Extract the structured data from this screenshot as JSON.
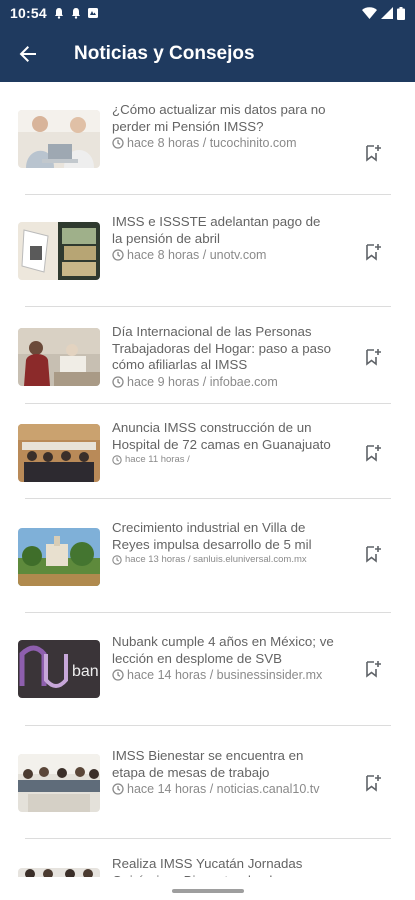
{
  "status_bar": {
    "time": "10:54",
    "left_icons": [
      "notification-bell-icon",
      "notification-bell-icon",
      "notification-app-icon"
    ],
    "right_icons": [
      "wifi-icon",
      "signal-icon",
      "battery-icon"
    ]
  },
  "appbar": {
    "title": "Noticias y Consejos",
    "back_icon": "arrow-left-icon",
    "background": "#1f3a5f"
  },
  "articles": [
    {
      "title": "¿Cómo actualizar mis datos para no perder mi Pensión IMSS?",
      "meta": "hace 8 horas / tucochinito.com"
    },
    {
      "title": "IMSS e ISSSTE adelantan pago de la pensión de abril",
      "meta": "hace 8 horas / unotv.com"
    },
    {
      "title": "Día Internacional de las Personas Trabajadoras del Hogar: paso a paso cómo afiliarlas al IMSS",
      "meta": "hace 9 horas / infobae.com"
    },
    {
      "title": "Anuncia IMSS construcción de un Hospital de 72 camas en Guanajuato",
      "meta": "hace 11 horas /"
    },
    {
      "title": "Crecimiento industrial en Villa de Reyes impulsa desarrollo de 5 mil",
      "meta": "hace 13 horas / sanluis.eluniversal.com.mx"
    },
    {
      "title": "Nubank cumple 4 años en México; ve lección en desplome de SVB",
      "meta": "hace 14 horas / businessinsider.mx"
    },
    {
      "title": "IMSS Bienestar se encuentra en etapa de mesas de trabajo",
      "meta": "hace 14 horas / noticias.canal10.tv"
    },
    {
      "title": "Realiza IMSS Yucatán Jornadas Quirúrgicas Bienestar de alcance",
      "meta": ""
    }
  ]
}
